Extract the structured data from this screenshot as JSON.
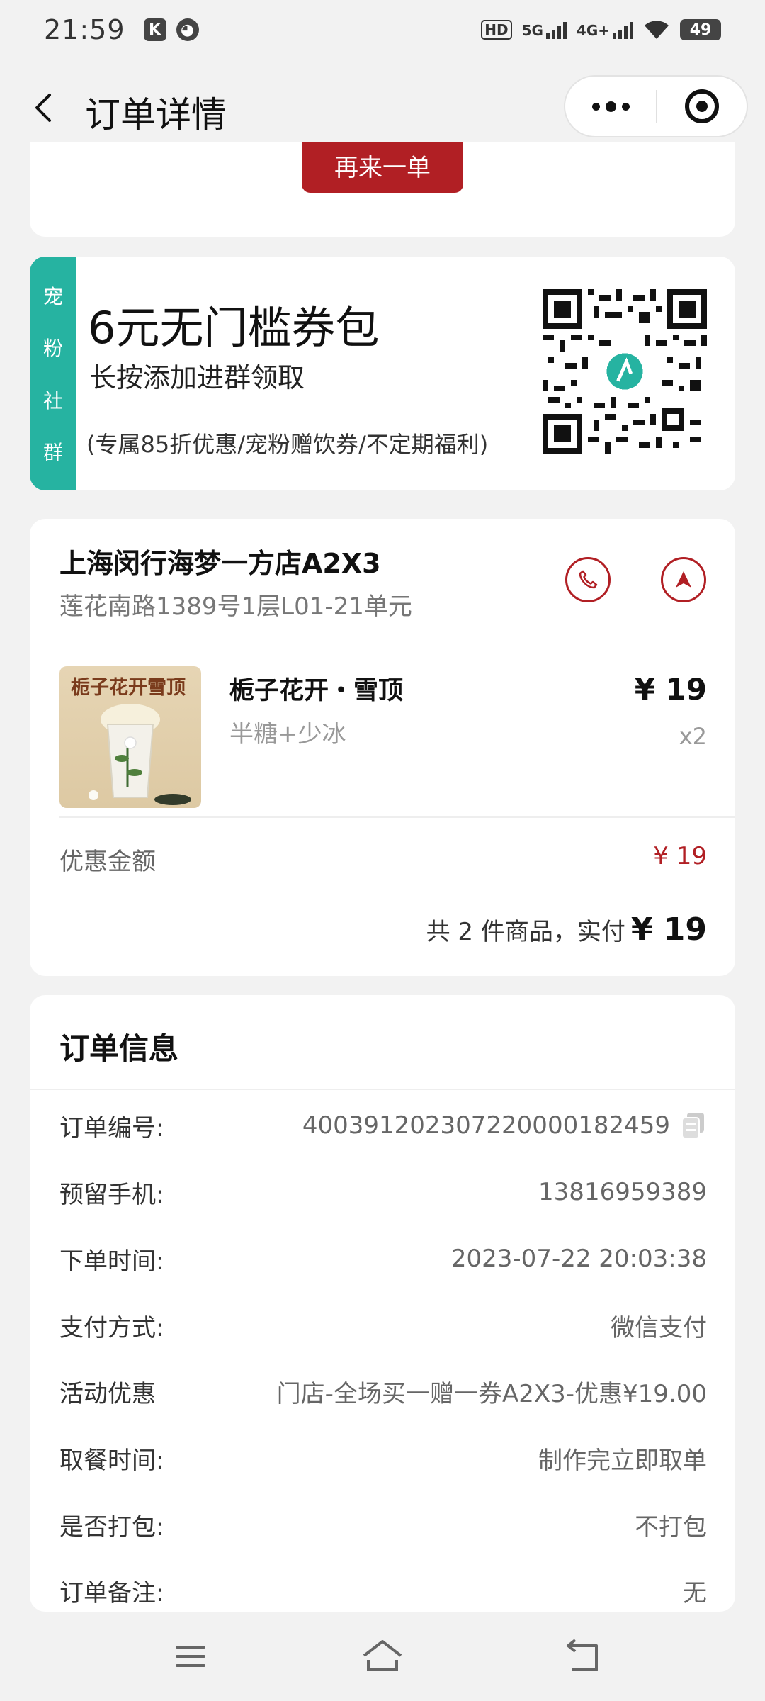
{
  "status_bar": {
    "time": "21:59",
    "battery": "49",
    "network_labels": [
      "HD",
      "5G",
      "4G+"
    ]
  },
  "header": {
    "title": "订单详情"
  },
  "reorder": {
    "button_label": "再来一单"
  },
  "coupon": {
    "tag_chars": [
      "宠",
      "粉",
      "社",
      "群"
    ],
    "title": "6元无门槛券包",
    "subtitle": "长按添加进群领取",
    "note": "(专属85折优惠/宠粉赠饮券/不定期福利)"
  },
  "store": {
    "name": "上海闵行海梦一方店A2X3",
    "address": "莲花南路1389号1层L01-21单元"
  },
  "product": {
    "image_text": "栀子花开雪顶",
    "name": "栀子花开・雪顶",
    "spec": "半糖+少冰",
    "price": "¥ 19",
    "qty": "x2"
  },
  "summary": {
    "discount_label": "优惠金额",
    "discount_value": "¥ 19",
    "total_text": "共 2 件商品，实付",
    "total_value": "¥ 19"
  },
  "order_info": {
    "title": "订单信息",
    "rows": [
      {
        "label": "订单编号:",
        "value": "400391202307220000182459"
      },
      {
        "label": "预留手机:",
        "value": "13816959389"
      },
      {
        "label": "下单时间:",
        "value": "2023-07-22 20:03:38"
      },
      {
        "label": "支付方式:",
        "value": "微信支付"
      },
      {
        "label": "活动优惠",
        "value": "门店-全场买一赠一券A2X3-优惠¥19.00"
      },
      {
        "label": "取餐时间:",
        "value": "制作完立即取单"
      },
      {
        "label": "是否打包:",
        "value": "不打包"
      },
      {
        "label": "订单备注:",
        "value": "无"
      }
    ]
  },
  "colors": {
    "brand_red": "#b11f24",
    "tag_teal": "#26b3a1",
    "background": "#f2f2f2"
  }
}
